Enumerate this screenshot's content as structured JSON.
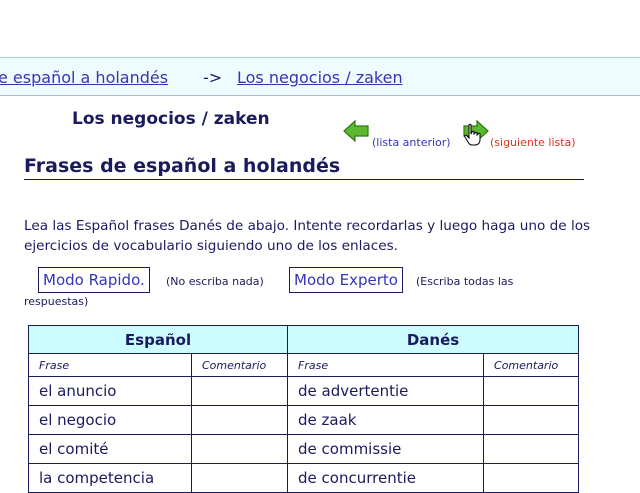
{
  "breadcrumb": {
    "parent_label": "e español a holandés",
    "separator": "->",
    "current_label": "Los negocios / zaken"
  },
  "list_title": "Los negocios / zaken",
  "nav": {
    "prev_label": "(lista anterior)",
    "next_label": "(siguiente lista)"
  },
  "section_title": "Frases de español a holandés",
  "intro_text": "Lea las Español frases Danés de abajo. Intente recordarlas y luego haga uno de los ejercicios de vocabulario siguiendo uno de los enlaces.",
  "modes": {
    "rapido_label": "Modo Rapido.",
    "rapido_note": "(No escriba nada)",
    "experto_label": "Modo Experto",
    "experto_note_1": "(Escriba todas las",
    "experto_note_2": "respuestas)"
  },
  "table": {
    "lang_headers": [
      "Español",
      "Danés"
    ],
    "sub_headers": [
      "Frase",
      "Comentario",
      "Frase",
      "Comentario"
    ],
    "rows": [
      [
        "el anuncio",
        "",
        "de advertentie",
        ""
      ],
      [
        "el negocio",
        "",
        "de zaak",
        ""
      ],
      [
        "el comité",
        "",
        "de commissie",
        ""
      ],
      [
        "la competencia",
        "",
        "de concurrentie",
        ""
      ]
    ]
  },
  "colors": {
    "link": "#3535b5",
    "text": "#1a1a5e",
    "next_link": "#e0301e",
    "header_bg": "#ccfcff",
    "breadcrumb_bg": "#eefcff",
    "arrow": "#5cb82e"
  },
  "icons": {
    "prev": "green-left-arrow",
    "next": "green-right-arrow",
    "cursor": "hand-pointer"
  }
}
